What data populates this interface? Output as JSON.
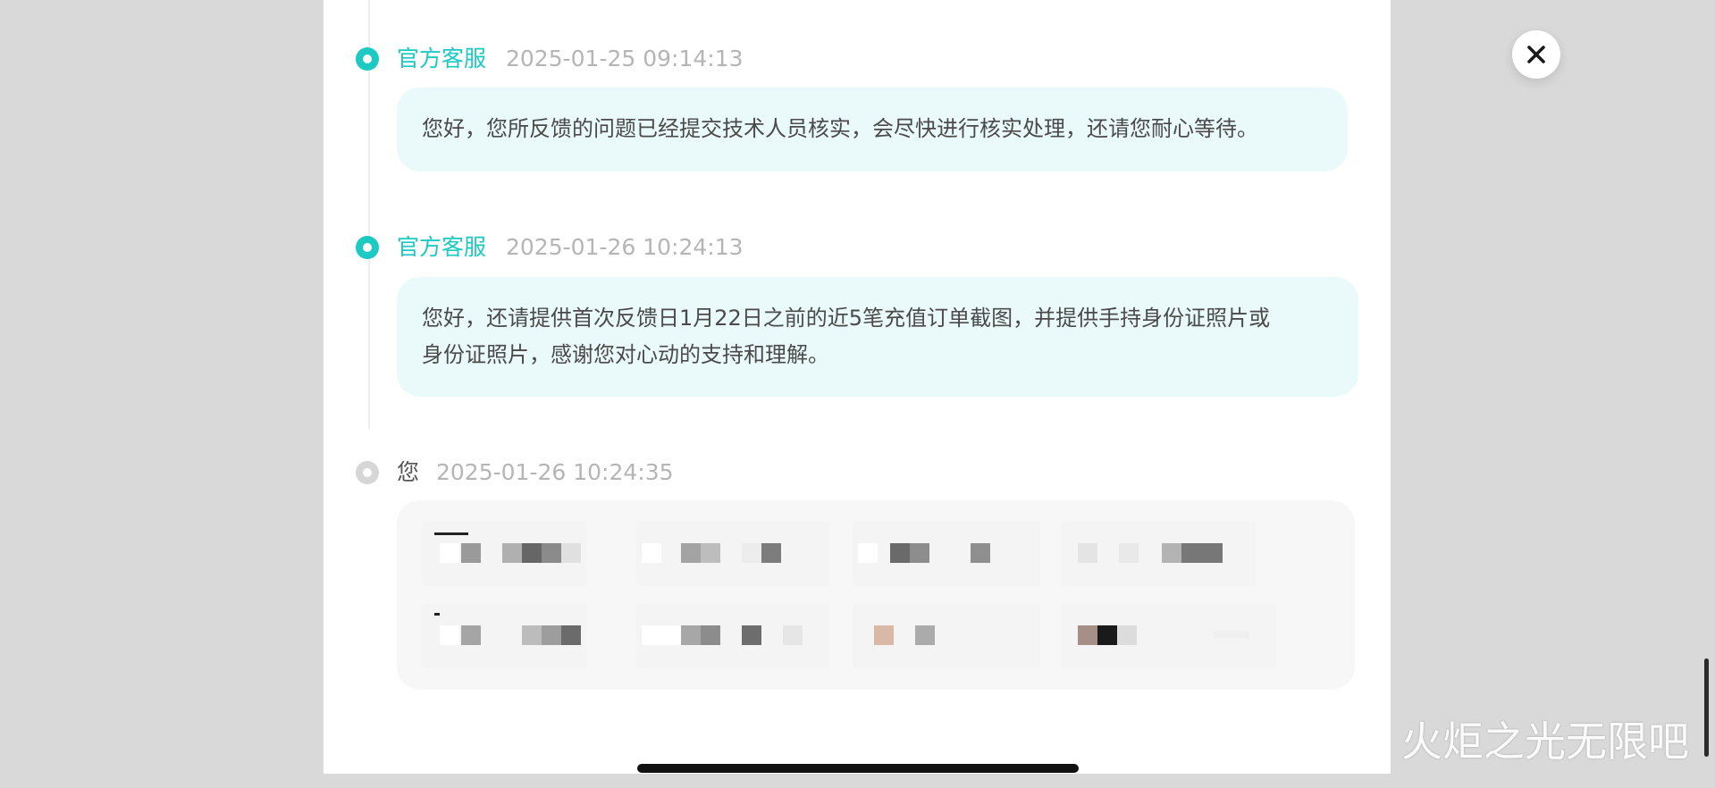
{
  "messages": [
    {
      "sender": "官方客服",
      "time": "2025-01-25 09:14:13",
      "lines": [
        "您好，您所反馈的问题已经提交技术人员核实，会尽快进行核实处理，还请您耐心等待。"
      ]
    },
    {
      "sender": "官方客服",
      "time": "2025-01-26 10:24:13",
      "lines": [
        "您好，还请提供首次反馈日1月22日之前的近5笔充值订单截图，并提供手持身份证照片或",
        "身份证照片，感谢您对心动的支持和理解。"
      ]
    },
    {
      "sender": "您",
      "time": "2025-01-26 10:24:35",
      "attachment_count": 8
    }
  ],
  "colors": {
    "accent": "#1dc9c3",
    "bubble": "#eafafa",
    "muted": "#b5b5b5"
  },
  "icons": {
    "close": "close-icon"
  },
  "watermark": "火炬之光无限吧"
}
